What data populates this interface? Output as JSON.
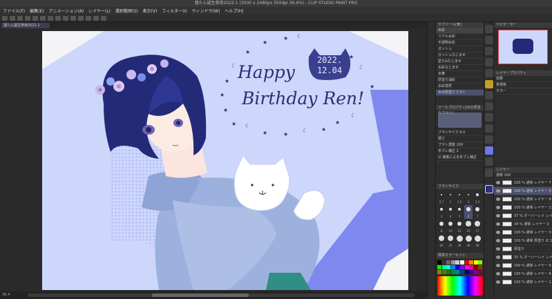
{
  "window": {
    "title": "蓮たん誕生祭用2022.1 (3500 x 2480px 350dpi 36.4%) - CLIP STUDIO PAINT PRO"
  },
  "menu": [
    "ファイル(F)",
    "編集(E)",
    "アニメーション(A)",
    "レイヤー(L)",
    "選択範囲(S)",
    "表示(V)",
    "フィルター(I)",
    "ウィンドウ(W)",
    "ヘルプ(H)"
  ],
  "document_tab": "蓮たん誕生祭用2022.1",
  "status": {
    "zoom": "36.4"
  },
  "artwork": {
    "headline_1": "Happy",
    "headline_2": "Birthday Ren!",
    "date_line_1": "2022.",
    "date_line_2": "12.04"
  },
  "subtool_panel": {
    "tab": "サブツール[筆]",
    "groups": [
      "水彩",
      "リアル水彩",
      "墨"
    ],
    "brushes": [
      "不透明水彩",
      "ガッシュ",
      "ガッシュなじませ",
      "塗り&なじませ",
      "水彩なじませ",
      "水筆",
      "厚塗り油彩",
      "水彩境界",
      "にじみ",
      "色鉛筆ハイライト",
      "木の厚塗りブラシ"
    ]
  },
  "tool_property": {
    "tab": "ツールプロパティ[木の厚塗りブラシ]",
    "rows": [
      {
        "label": "ブラシサイズ",
        "value": "6.0"
      },
      {
        "label": "硬さ",
        "value": ""
      },
      {
        "label": "ブラシ濃度",
        "value": "100"
      },
      {
        "label": "手ブレ補正",
        "value": "2"
      },
      {
        "label": "速度による手ブレ補正",
        "value": ""
      }
    ]
  },
  "brush_size_panel": {
    "tab": "ブラシサイズ",
    "sizes": [
      "0.7",
      "1",
      "1.5",
      "2",
      "2.5",
      "3",
      "4",
      "5",
      "6",
      "7",
      "8",
      "10",
      "12",
      "15",
      "17",
      "20",
      "25",
      "30",
      "40",
      "50"
    ]
  },
  "color_panel": {
    "tab": "標準カラーセット"
  },
  "navigator": {
    "tab": "ナビゲーター"
  },
  "layer_property": {
    "tab": "レイヤープロパティ",
    "effect_label": "効果",
    "expression_label": "表現色",
    "expression_value": "カラー"
  },
  "layer_panel": {
    "tab": "レイヤー",
    "blend": "通常",
    "opacity": "100",
    "layers": [
      {
        "name": "100 % 通常 レイヤー 7"
      },
      {
        "name": "100 % 通常 レイヤー 5"
      },
      {
        "name": "100 % 通常 レイヤー 9"
      },
      {
        "name": "100 % 通常 レイヤー 11"
      },
      {
        "name": "37 % オーバーレイ レイヤー 12"
      },
      {
        "name": "34 % 通常 レイヤー 3"
      },
      {
        "name": "100 % 通常 レイヤー 3"
      },
      {
        "name": "100 % 通常 厚塗り のコピー 2"
      },
      {
        "name": "厚塗り"
      },
      {
        "name": "31 % オーバーレイ レイヤー 10"
      },
      {
        "name": "100 % 通常 レイヤー 9"
      },
      {
        "name": "100 % 通常 レイヤー 8"
      },
      {
        "name": "100 % 通常 レイヤー 1"
      }
    ]
  },
  "colors": {
    "accent": "#6b78e8",
    "bg_light": "#cdd7fb",
    "hair": "#232a78",
    "headline": "#2c2f72"
  }
}
